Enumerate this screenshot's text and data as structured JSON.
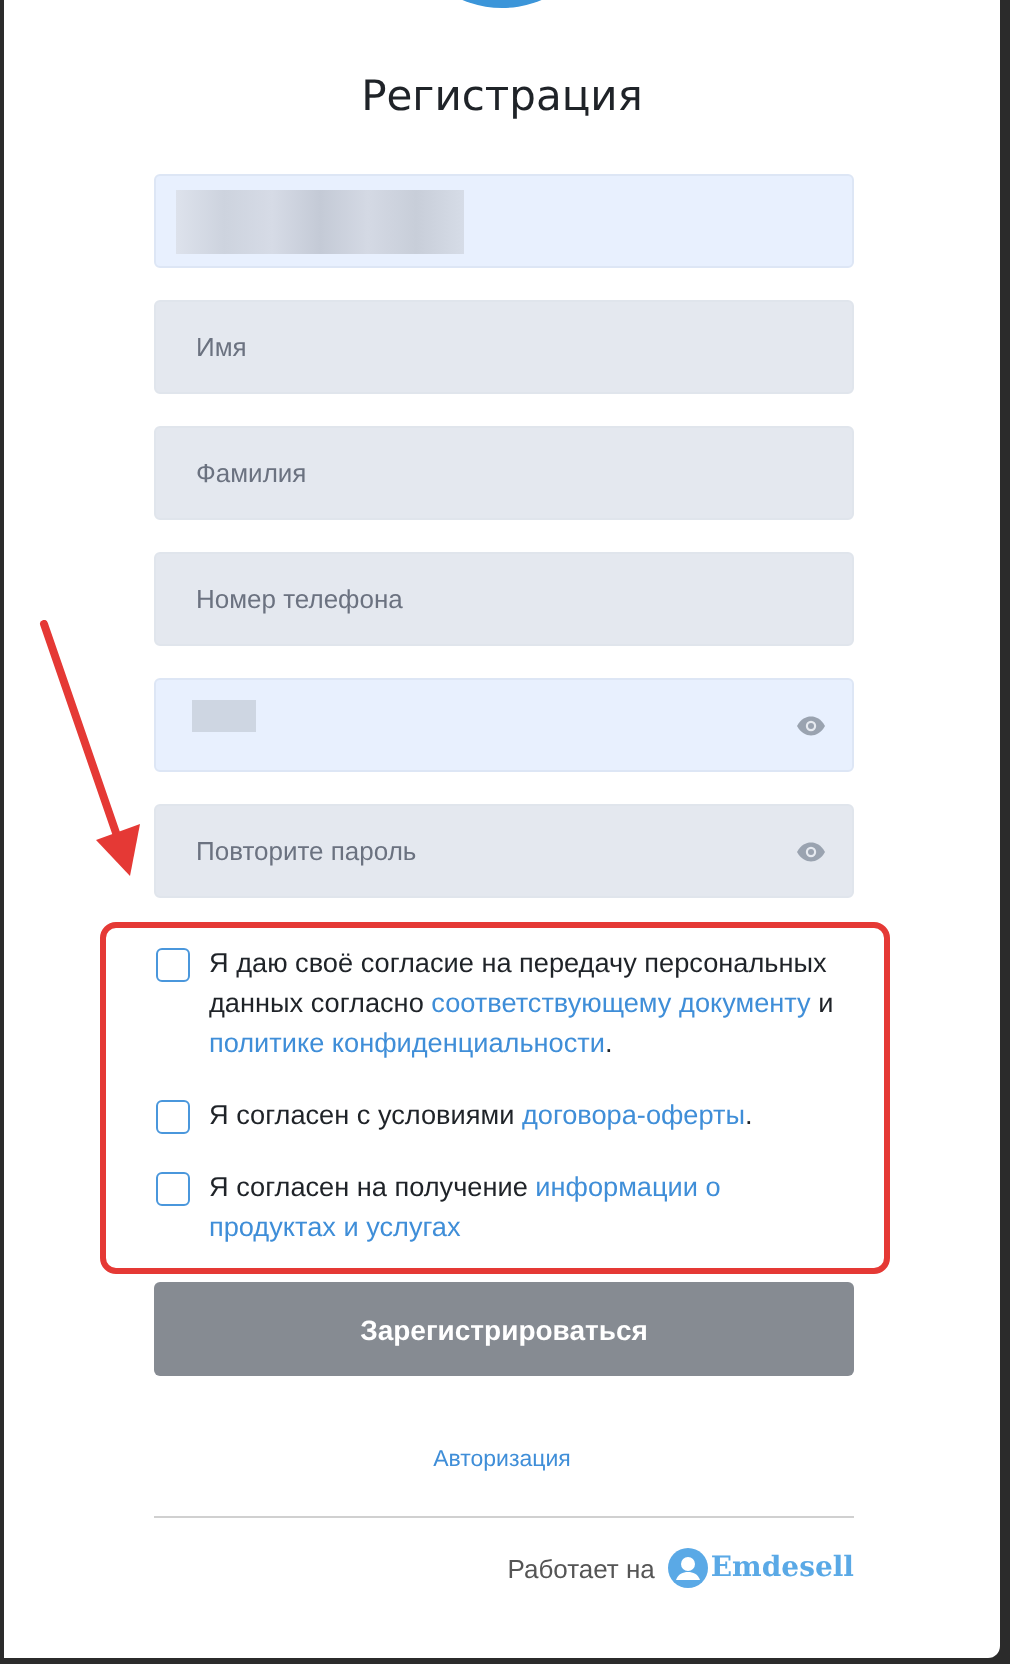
{
  "title": "Регистрация",
  "fields": [
    {
      "kind": "redacted",
      "autofilled": true,
      "eye": false
    },
    {
      "kind": "text",
      "placeholder": "Имя",
      "autofilled": false,
      "eye": false
    },
    {
      "kind": "text",
      "placeholder": "Фамилия",
      "autofilled": false,
      "eye": false
    },
    {
      "kind": "text",
      "placeholder": "Номер телефона",
      "autofilled": false,
      "eye": false
    },
    {
      "kind": "redacted",
      "autofilled": true,
      "eye": true
    },
    {
      "kind": "text",
      "placeholder": "Повторите пароль",
      "autofilled": false,
      "eye": true
    }
  ],
  "consents": [
    {
      "checked": false,
      "parts": [
        {
          "kind": "text",
          "text": "Я даю своё согласие на передачу персональных данных согласно "
        },
        {
          "kind": "link",
          "text": "соответствующему документу"
        },
        {
          "kind": "text",
          "text": " и "
        },
        {
          "kind": "link",
          "text": "политике конфиденциальности"
        },
        {
          "kind": "text",
          "text": "."
        }
      ]
    },
    {
      "checked": false,
      "parts": [
        {
          "kind": "text",
          "text": "Я согласен с условиями "
        },
        {
          "kind": "link",
          "text": "договора-оферты"
        },
        {
          "kind": "text",
          "text": "."
        }
      ]
    },
    {
      "checked": false,
      "parts": [
        {
          "kind": "text",
          "text": "Я согласен на получение "
        },
        {
          "kind": "link",
          "text": "информации о"
        },
        {
          "kind": "link",
          "text": "продуктах и услугах"
        }
      ]
    }
  ],
  "submit": {
    "label": "Зарегистрироваться",
    "disabled": true
  },
  "login_link": "Авторизация",
  "footer": {
    "text": "Работает на",
    "brand": "Emdesell"
  }
}
